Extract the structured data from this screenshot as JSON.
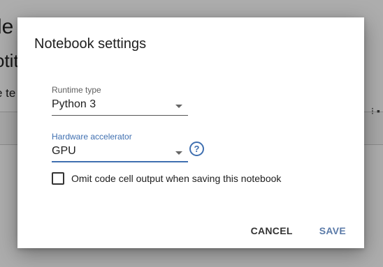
{
  "background": {
    "title_fragment": "le",
    "heading_fragment": "otit",
    "body_fragment": "e te"
  },
  "dialog": {
    "title": "Notebook settings",
    "runtime": {
      "label": "Runtime type",
      "value": "Python 3"
    },
    "hardware": {
      "label": "Hardware accelerator",
      "value": "GPU",
      "help_icon": "help-circle-icon",
      "help_glyph": "?"
    },
    "omit_output": {
      "label": "Omit code cell output when saving this notebook",
      "checked": false
    },
    "actions": {
      "cancel": "CANCEL",
      "save": "SAVE"
    }
  },
  "colors": {
    "accent": "#3f6fb0",
    "save_button": "#5a7aa8"
  }
}
